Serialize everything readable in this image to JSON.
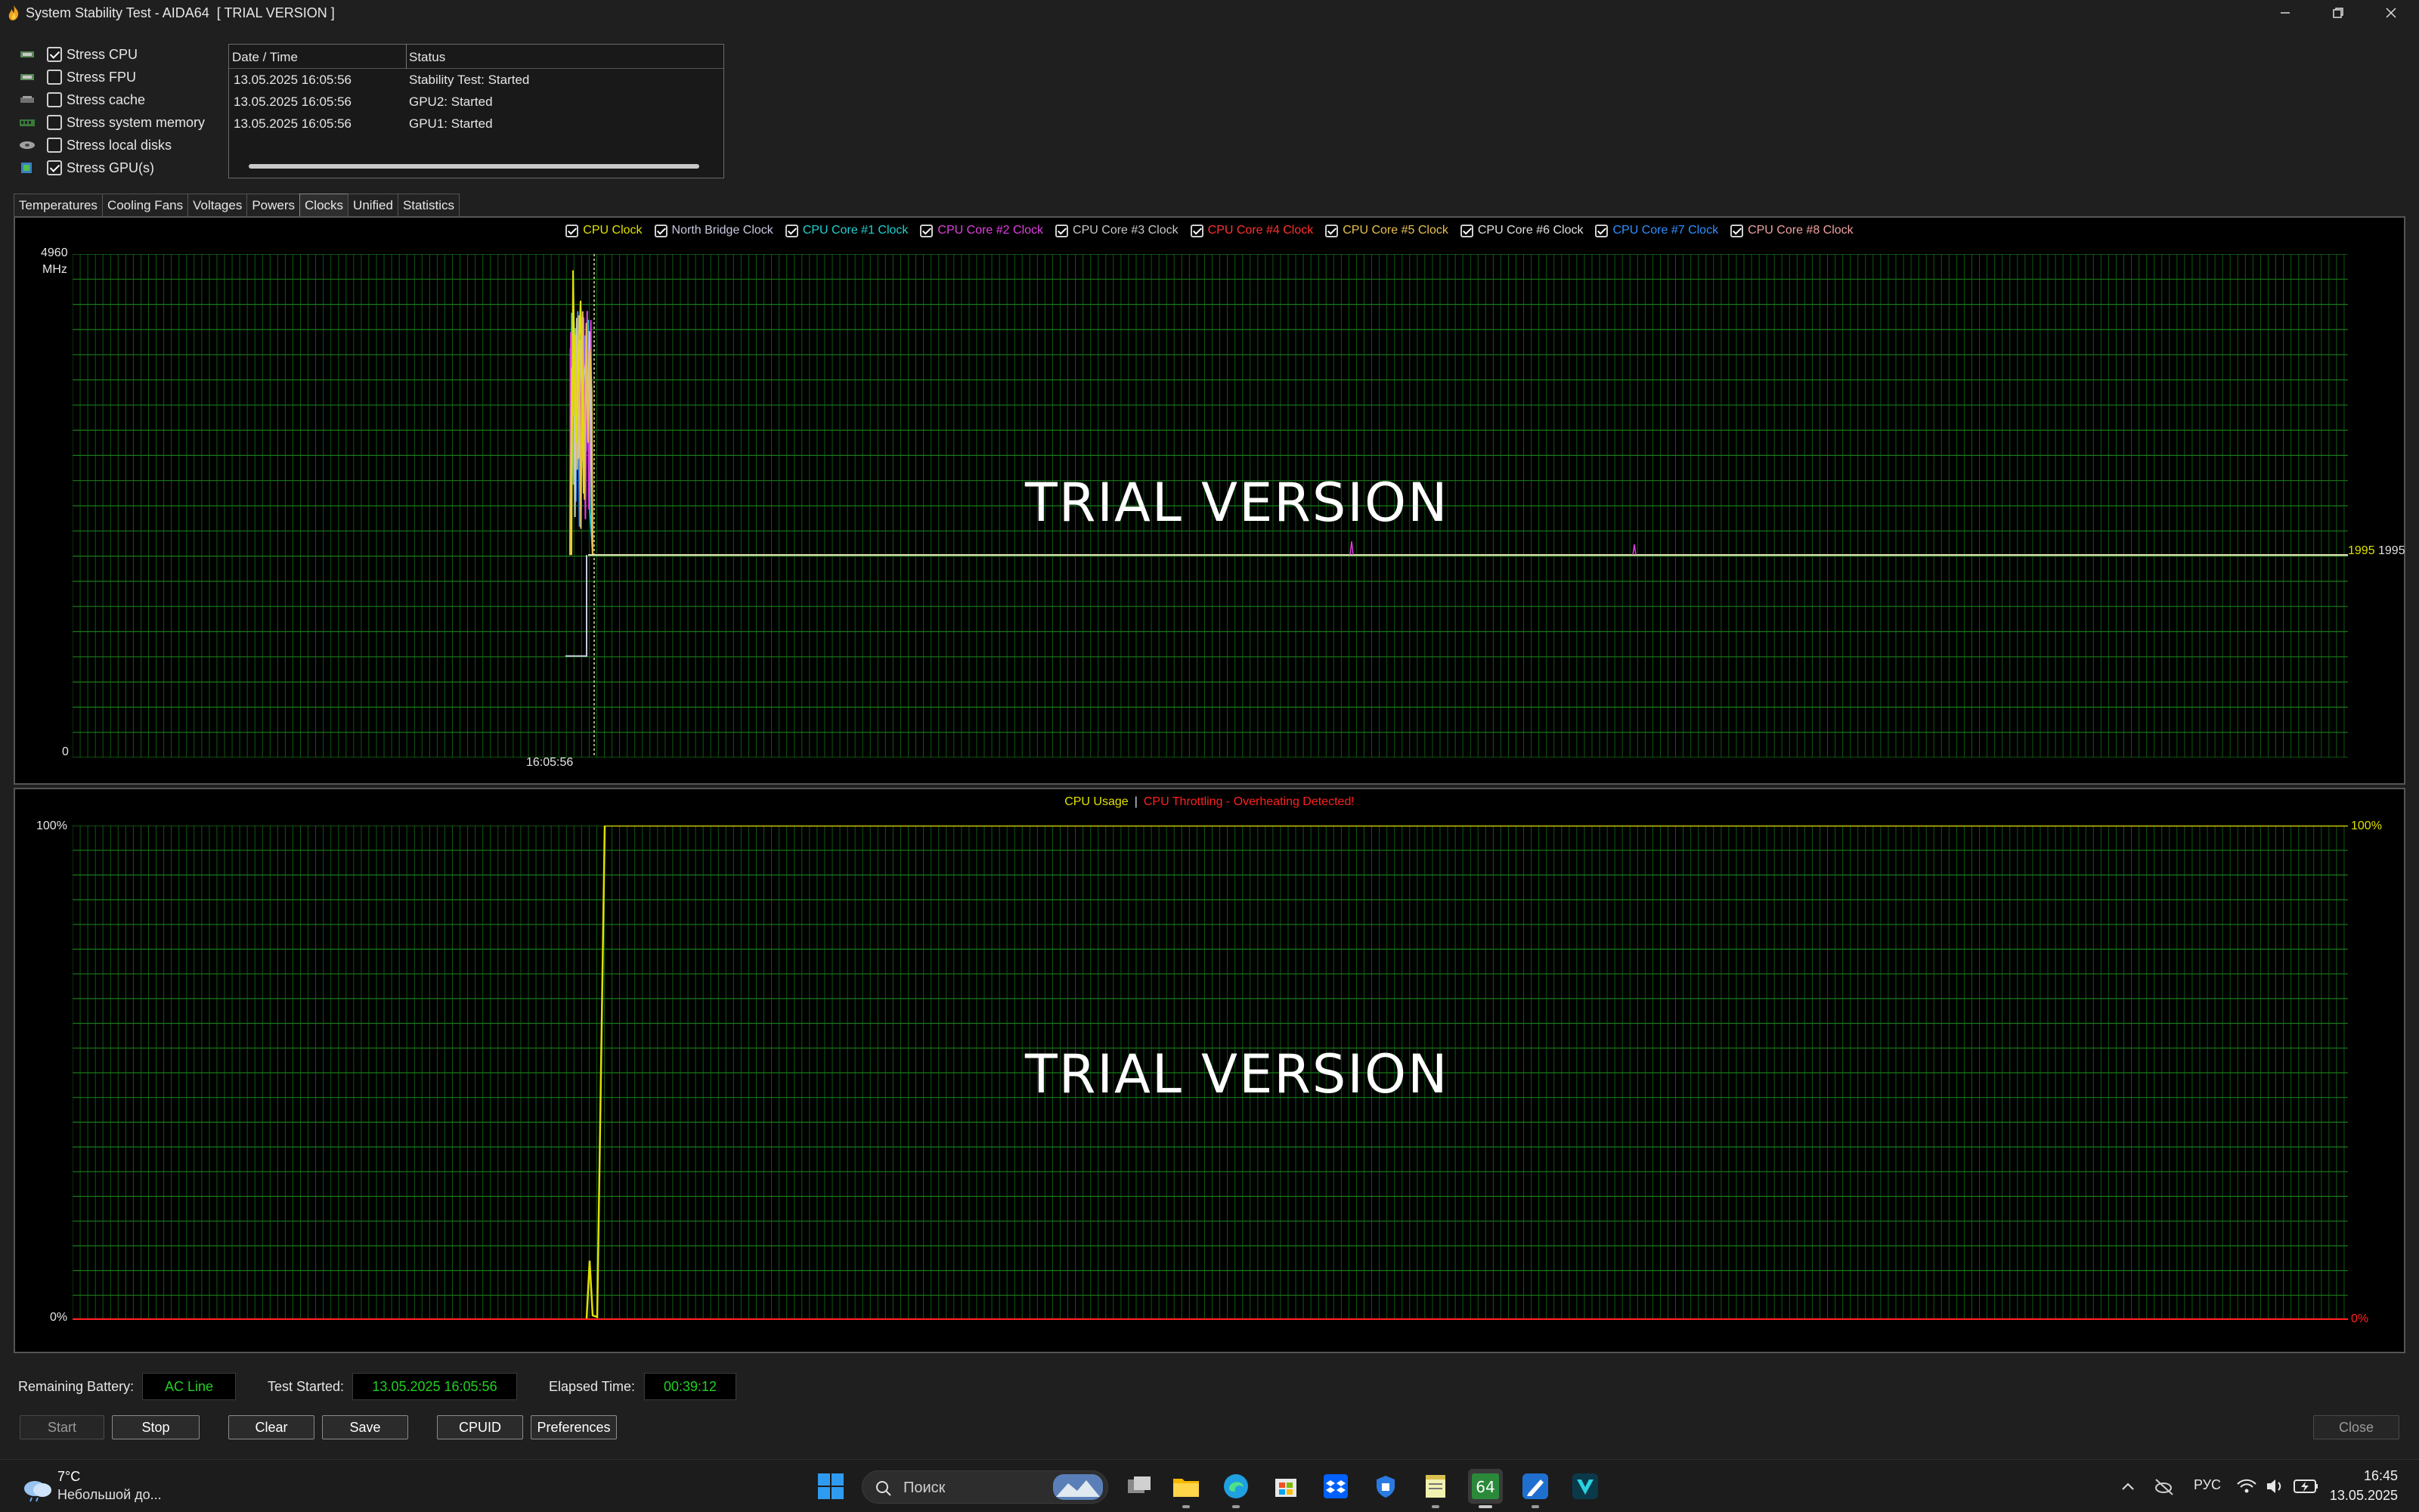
{
  "window": {
    "title": "System Stability Test - AIDA64  [ TRIAL VERSION ]",
    "minimize_icon": "minimize-icon",
    "maximize_icon": "restore-icon",
    "close_icon": "close-icon"
  },
  "stress_options": [
    {
      "label": "Stress CPU",
      "checked": true,
      "icon": "cpu-icon"
    },
    {
      "label": "Stress FPU",
      "checked": false,
      "icon": "fpu-icon"
    },
    {
      "label": "Stress cache",
      "checked": false,
      "icon": "cache-icon"
    },
    {
      "label": "Stress system memory",
      "checked": false,
      "icon": "memory-icon"
    },
    {
      "label": "Stress local disks",
      "checked": false,
      "icon": "disk-icon"
    },
    {
      "label": "Stress GPU(s)",
      "checked": true,
      "icon": "gpu-icon"
    }
  ],
  "log": {
    "headers": [
      "Date / Time",
      "Status"
    ],
    "rows": [
      {
        "time": "13.05.2025 16:05:56",
        "status": "Stability Test: Started"
      },
      {
        "time": "13.05.2025 16:05:56",
        "status": "GPU2: Started"
      },
      {
        "time": "13.05.2025 16:05:56",
        "status": "GPU1: Started"
      }
    ]
  },
  "tabs": [
    "Temperatures",
    "Cooling Fans",
    "Voltages",
    "Powers",
    "Clocks",
    "Unified",
    "Statistics"
  ],
  "active_tab": "Clocks",
  "chart_data": [
    {
      "type": "line",
      "series": [
        {
          "name": "CPU Clock",
          "color": "#e0e000",
          "checked": true
        },
        {
          "name": "North Bridge Clock",
          "color": "#c8c8e0",
          "checked": true
        },
        {
          "name": "CPU Core #1 Clock",
          "color": "#20d0d0",
          "checked": true
        },
        {
          "name": "CPU Core #2 Clock",
          "color": "#e040e0",
          "checked": true
        },
        {
          "name": "CPU Core #3 Clock",
          "color": "#c8c8c8",
          "checked": true
        },
        {
          "name": "CPU Core #4 Clock",
          "color": "#ff3030",
          "checked": true
        },
        {
          "name": "CPU Core #5 Clock",
          "color": "#e8c050",
          "checked": true
        },
        {
          "name": "CPU Core #6 Clock",
          "color": "#e0e0e0",
          "checked": true
        },
        {
          "name": "CPU Core #7 Clock",
          "color": "#3090ff",
          "checked": true
        },
        {
          "name": "CPU Core #8 Clock",
          "color": "#f0a0a0",
          "checked": true
        }
      ],
      "y_top": "4960",
      "y_unit": "MHz",
      "y_bottom": "0",
      "ylim": [
        0,
        4960
      ],
      "x_label": "16:05:56",
      "value_label_1": "1995",
      "value_label_2": "1995",
      "steady_value": 1995,
      "watermark": "TRIAL VERSION"
    },
    {
      "type": "line",
      "series": [
        {
          "name": "CPU Usage",
          "color": "#e0e000"
        },
        {
          "name": "CPU Throttling - Overheating Detected!",
          "color": "#ff2020"
        }
      ],
      "separator": "|",
      "y_top": "100%",
      "y_bottom": "0%",
      "right_top": "100%",
      "right_bottom": "0%",
      "ylim": [
        0,
        100
      ],
      "steady_value": 100,
      "watermark": "TRIAL VERSION"
    }
  ],
  "status": {
    "battery_label": "Remaining Battery:",
    "battery_value": "AC Line",
    "started_label": "Test Started:",
    "started_value": "13.05.2025 16:05:56",
    "elapsed_label": "Elapsed Time:",
    "elapsed_value": "00:39:12"
  },
  "buttons": {
    "start": "Start",
    "stop": "Stop",
    "clear": "Clear",
    "save": "Save",
    "cpuid": "CPUID",
    "preferences": "Preferences",
    "close": "Close"
  },
  "taskbar": {
    "weather_temp": "7°C",
    "weather_desc": "Небольшой до...",
    "search_placeholder": "Поиск",
    "language": "РУС",
    "time": "16:45",
    "date": "13.05.2025"
  }
}
